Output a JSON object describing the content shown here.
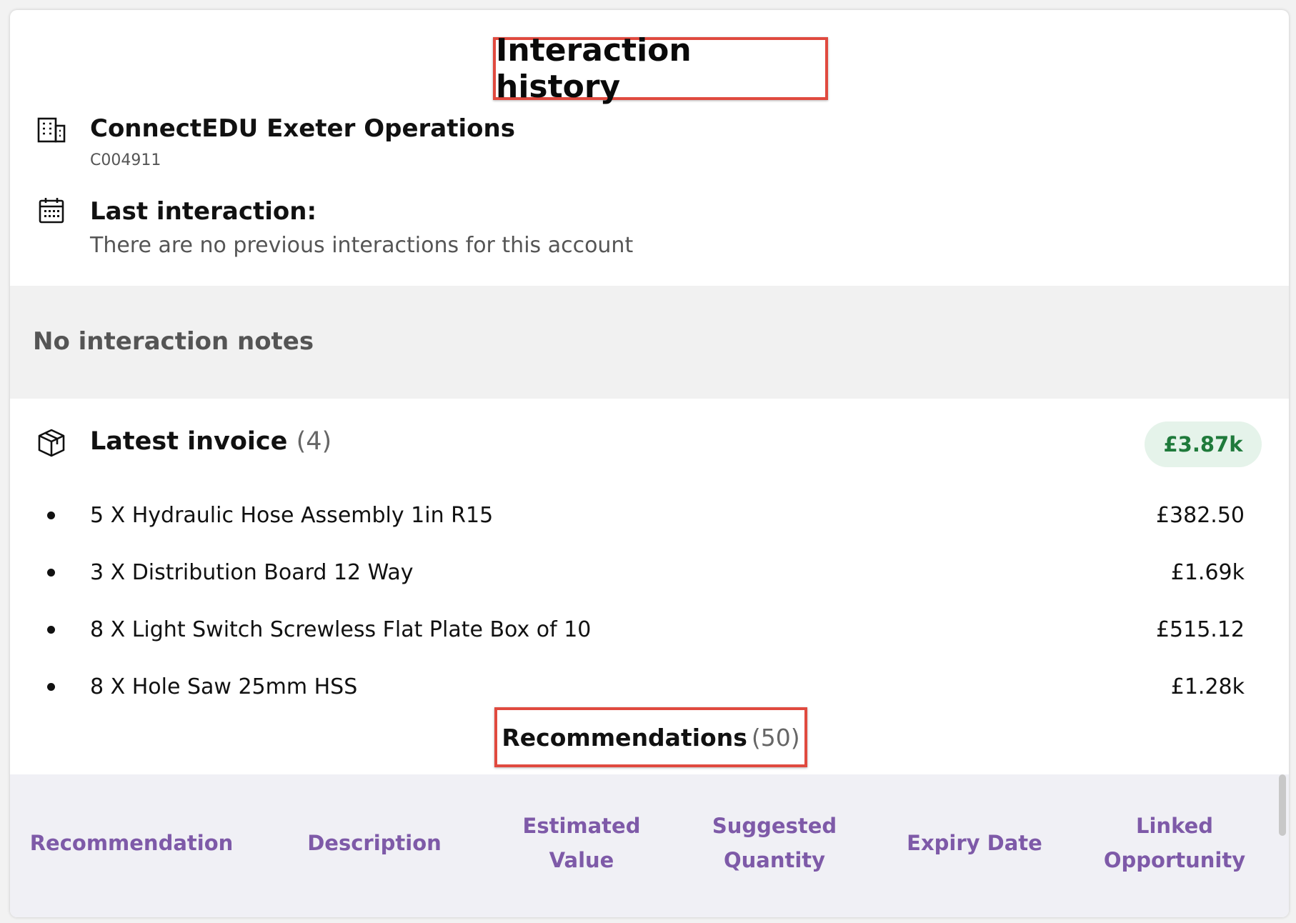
{
  "header": {
    "title": "Interaction history"
  },
  "account": {
    "icon": "building-icon",
    "name": "ConnectEDU Exeter Operations",
    "id": "C004911"
  },
  "last_interaction": {
    "icon": "calendar-icon",
    "label": "Last interaction:",
    "text": "There are no previous interactions for this account"
  },
  "notes": {
    "text": "No interaction notes"
  },
  "invoice": {
    "icon": "package-icon",
    "title": "Latest invoice",
    "count": "(4)",
    "total": "£3.87k",
    "items": [
      {
        "text": "5 X Hydraulic Hose Assembly 1in R15",
        "price": "£382.50"
      },
      {
        "text": "3 X Distribution Board 12 Way",
        "price": "£1.69k"
      },
      {
        "text": "8 X Light Switch Screwless Flat Plate Box of 10",
        "price": "£515.12"
      },
      {
        "text": "8 X Hole Saw 25mm HSS",
        "price": "£1.28k"
      }
    ]
  },
  "recommendations": {
    "title": "Recommendations",
    "count": "(50)",
    "columns": [
      "Recommendation",
      "Description",
      "Estimated Value",
      "Suggested Quantity",
      "Expiry Date",
      "Linked Opportunity"
    ]
  },
  "colors": {
    "highlight": "#e04a3f",
    "accent": "#7e5aa8",
    "total_text": "#1f7a3b",
    "total_bg": "#e5f3ea"
  }
}
